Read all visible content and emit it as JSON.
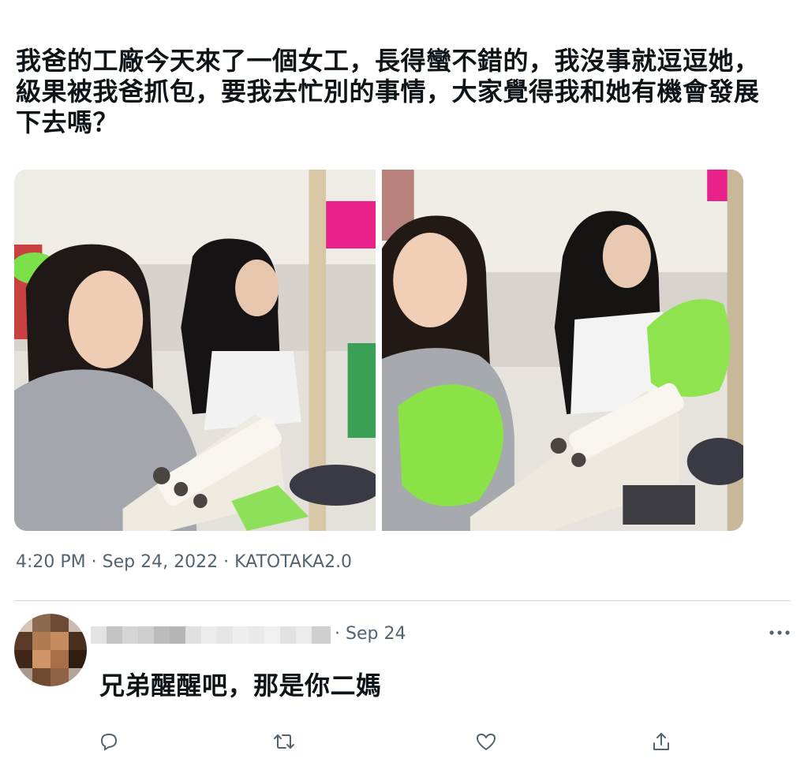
{
  "tweet": {
    "text": "我爸的工廠今天來了一個女工，長得蠻不錯的，我沒事就逗逗她，級果被我爸抓包，要我去忙別的事情，大家覺得我和她有機會發展下去嗎？",
    "meta": {
      "time": "4:20 PM",
      "separator_1": " · ",
      "date": "Sep 24, 2022",
      "separator_2": " · ",
      "source": "KATOTAKA2.0"
    },
    "media": [
      {
        "icon": "photo-sewing-workshop-left"
      },
      {
        "icon": "photo-sewing-workshop-right"
      }
    ]
  },
  "reply": {
    "date": "· Sep 24",
    "text": "兄弟醒醒吧，那是你二媽",
    "actions": [
      "reply-icon",
      "retweet-icon",
      "like-icon",
      "share-icon"
    ]
  },
  "colors": {
    "text": "#0f1419",
    "secondary": "#536471",
    "divider": "#cfd9de"
  }
}
